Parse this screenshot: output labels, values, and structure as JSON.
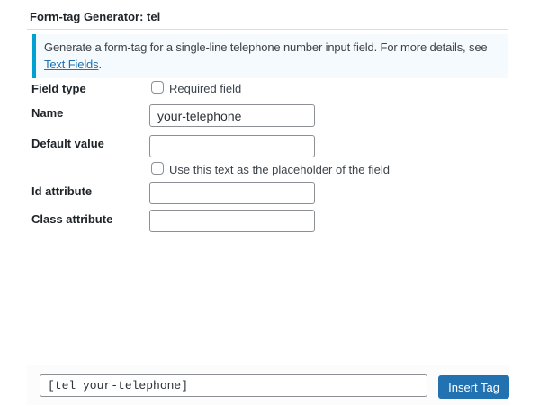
{
  "header": {
    "title": "Form-tag Generator: tel"
  },
  "info": {
    "text": "Generate a form-tag for a single-line telephone number input field. For more details, see ",
    "link_label": "Text Fields",
    "suffix": "."
  },
  "form": {
    "field_type": {
      "label": "Field type",
      "checkbox_label": "Required field",
      "checked": false
    },
    "name": {
      "label": "Name",
      "value": "your-telephone"
    },
    "default_value": {
      "label": "Default value",
      "value": "",
      "placeholder_checkbox_label": "Use this text as the placeholder of the field",
      "checked": false
    },
    "id_attribute": {
      "label": "Id attribute",
      "value": ""
    },
    "class_attribute": {
      "label": "Class attribute",
      "value": ""
    }
  },
  "footer": {
    "tag_text": "[tel your-telephone]",
    "insert_button_label": "Insert Tag"
  },
  "colors": {
    "info_accent": "#00a0d2",
    "info_background": "#f4fafd",
    "link": "#2271b1",
    "button_background": "#2271b1",
    "input_border": "#8c8f94",
    "divider": "#dcdcde"
  }
}
